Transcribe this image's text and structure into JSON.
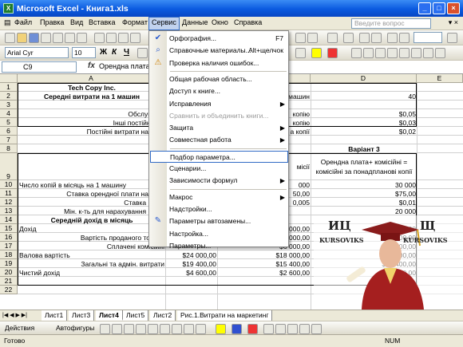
{
  "window": {
    "title": "Microsoft Excel - Книга1.xls",
    "icon": "excel-icon"
  },
  "menubar": {
    "items": [
      "Файл",
      "Правка",
      "Вид",
      "Вставка",
      "Формат",
      "Сервис",
      "Данные",
      "Окно",
      "Справка"
    ],
    "active": "Сервис",
    "question_placeholder": "Введите вопрос"
  },
  "toolbar": {
    "font_name": "Arial Cyr",
    "font_size": "10",
    "bold": "Ж",
    "italic": "К",
    "underline": "Ч"
  },
  "formula_bar": {
    "cell_ref": "C9",
    "fx": "fx",
    "content": "Орендна плата"
  },
  "columns": [
    "A",
    "B",
    "C",
    "D",
    "E"
  ],
  "rows": [
    {
      "n": "1",
      "a": "Tech Copy Inc."
    },
    {
      "n": "2",
      "a": "Середні витрати на 1 машин",
      "c": "машин",
      "d": "40"
    },
    {
      "n": "3",
      "a": "Ор"
    },
    {
      "n": "4",
      "a": "Обслуговув",
      "c": "копію",
      "d": "$0,05"
    },
    {
      "n": "5",
      "a": "Інші постійні вит",
      "c": "копію",
      "d": "$0,03"
    },
    {
      "n": "6",
      "a": "Постійні витрати на 1 ма",
      "c": "а копії",
      "d": "$0,02"
    },
    {
      "n": "7"
    },
    {
      "n": "8",
      "d": "Варіант 3"
    },
    {
      "n": "9",
      "c": "місії",
      "d": "Орендна плата+ комісійні = комісійні за понадпланові копії"
    },
    {
      "n": "10",
      "a": "Число копій в місяць на 1 машину",
      "c": "000",
      "d": "30 000"
    },
    {
      "n": "11",
      "a": "Ставка орендної плати на 1 ма",
      "c": "50,00",
      "d": "$75,00"
    },
    {
      "n": "12",
      "a": "Ставка коміс",
      "c": "0,005",
      "d": "$0,01"
    },
    {
      "n": "13",
      "a": "Мін. к-ть для нарахування коміс",
      "d": "20 000"
    },
    {
      "n": "14",
      "a": "Середній дохід в місяць"
    },
    {
      "n": "15",
      "a": "Дохід",
      "b": "$66 000,00",
      "c": "$60 000,00",
      "d": "$60 000,00"
    },
    {
      "n": "16",
      "a": "Вартість проданого товару",
      "b": "$36 000,00",
      "c": "$36 000,00",
      "d": "$36 000,00"
    },
    {
      "n": "17",
      "a": "Сплачені комісійні",
      "c": "$6 000,00",
      "d": "$100,00"
    },
    {
      "n": "18",
      "a": "Валова вартість",
      "b": "$24 000,00",
      "c": "$18 000,00",
      "d": "$23 000,00"
    },
    {
      "n": "19",
      "a": "Загальні та адмін. витрати",
      "b": "$19 400,00",
      "c": "$15 400,00",
      "d": "$19 400,00"
    },
    {
      "n": "20",
      "a": "Чистий дохід",
      "b": "$4 600,00",
      "c": "$2 600,00",
      "d": "$3 600,00"
    },
    {
      "n": "21"
    },
    {
      "n": "22"
    }
  ],
  "sheet_tabs": [
    "Лист1",
    "Лист3",
    "Лист4",
    "Лист5",
    "Лист2",
    "Рис.1.Витрати на маркетинг"
  ],
  "active_tab": "Лист4",
  "drawing_bar": {
    "actions": "Действия",
    "autoshapes": "Автофигуры"
  },
  "status": {
    "left": "Готово",
    "right": "NUM"
  },
  "service_menu": {
    "items": [
      {
        "label": "Орфография...",
        "shortcut": "F7",
        "icon": "spellcheck-icon"
      },
      {
        "label": "Справочные материалы...",
        "shortcut": "Alt+щелчок",
        "icon": "research-icon"
      },
      {
        "label": "Проверка наличия ошибок...",
        "icon": "error-check-icon"
      },
      {
        "sep": true
      },
      {
        "label": "Общая рабочая область..."
      },
      {
        "label": "Доступ к книге..."
      },
      {
        "label": "Исправления",
        "submenu": true
      },
      {
        "label": "Сравнить и объединить книги...",
        "disabled": true
      },
      {
        "label": "Защита",
        "submenu": true
      },
      {
        "label": "Совместная работа",
        "submenu": true
      },
      {
        "sep": true
      },
      {
        "label": "Подбор параметра...",
        "highlight": true
      },
      {
        "label": "Сценарии..."
      },
      {
        "label": "Зависимости формул",
        "submenu": true
      },
      {
        "sep": true
      },
      {
        "label": "Макрос",
        "submenu": true
      },
      {
        "label": "Надстройки..."
      },
      {
        "label": "Параметры автозамены...",
        "icon": "autocorrect-icon"
      },
      {
        "label": "Настройка..."
      },
      {
        "label": "Параметры..."
      }
    ]
  },
  "watermark": {
    "left_big": "ИЦ",
    "right_big": "Щ",
    "left_small": "KURSOVIKS",
    "right_small": "KURSOVIKS"
  }
}
